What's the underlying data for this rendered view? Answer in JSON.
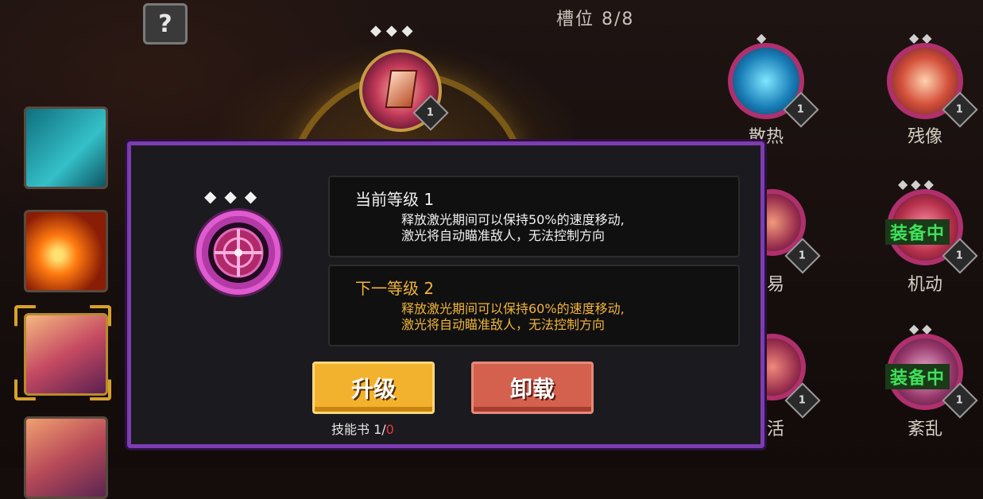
{
  "header": {
    "help_icon_text": "?",
    "slot_count": "槽位 8/8"
  },
  "top_orb": {
    "dots": "◆◆◆",
    "level": "1"
  },
  "right_skills": [
    {
      "label": "散热",
      "level": "1",
      "dots": "◆"
    },
    {
      "label": "残像",
      "level": "1",
      "dots": "◆◆"
    },
    {
      "label": "易",
      "level": "1",
      "dots": "◆"
    },
    {
      "label": "机动",
      "level": "1",
      "dots": "◆◆◆",
      "status": "装备中"
    },
    {
      "label": "活",
      "level": "1",
      "dots": ""
    },
    {
      "label": "紊乱",
      "level": "1",
      "dots": "◆◆",
      "status": "装备中"
    }
  ],
  "modal": {
    "dots": "◆◆◆",
    "current": {
      "title": "当前等级 1",
      "line1": "释放激光期间可以保持50%的速度移动,",
      "line2": "激光将自动瞄准敌人，无法控制方向"
    },
    "next": {
      "title": "下一等级 2",
      "line1": "释放激光期间可以保持60%的速度移动,",
      "line2": "激光将自动瞄准敌人，无法控制方向"
    },
    "upgrade_label": "升级",
    "unload_label": "卸载",
    "skillbook_label": "技能书 1/",
    "skillbook_required": "0"
  },
  "colors": {
    "modal_border": "#7d3cb0",
    "upgrade_button": "#f3b22d",
    "unload_button": "#d4604e",
    "equipped_text": "#3fe15b",
    "next_level_text": "#f0b43a"
  }
}
